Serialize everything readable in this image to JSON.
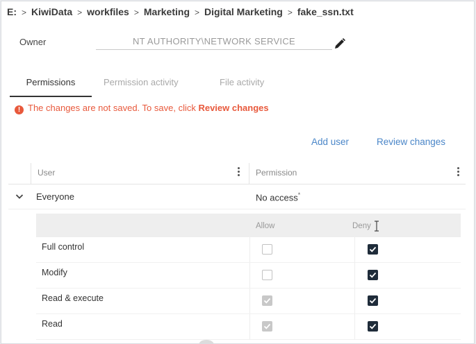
{
  "breadcrumb": [
    "E:",
    "KiwiData",
    "workfiles",
    "Marketing",
    "Digital Marketing",
    "fake_ssn.txt"
  ],
  "breadcrumb_separator": ">",
  "owner": {
    "label": "Owner",
    "value": "NT AUTHORITY\\NETWORK SERVICE"
  },
  "tabs": [
    {
      "label": "Permissions",
      "active": true
    },
    {
      "label": "Permission activity",
      "active": false
    },
    {
      "label": "File activity",
      "active": false
    }
  ],
  "warning": {
    "icon": "!",
    "text": "The changes are not saved. To save, click ",
    "link": "Review changes"
  },
  "actions": {
    "add_user": "Add user",
    "review_changes": "Review changes"
  },
  "grid": {
    "columns": [
      "User",
      "Permission"
    ],
    "rows": [
      {
        "user": "Everyone",
        "permission": "No access",
        "marker": "*",
        "expanded": true
      }
    ]
  },
  "permissions_table": {
    "columns": [
      "Allow",
      "Deny"
    ],
    "rows": [
      {
        "name": "Full control",
        "allow": "unchecked",
        "deny": "checked"
      },
      {
        "name": "Modify",
        "allow": "unchecked",
        "deny": "checked"
      },
      {
        "name": "Read & execute",
        "allow": "checked-disabled",
        "deny": "checked"
      },
      {
        "name": "Read",
        "allow": "checked-disabled",
        "deny": "checked"
      }
    ]
  },
  "colors": {
    "warning": "#e8593c",
    "link": "#4a86c8",
    "checkbox_checked": "#1f2c3a",
    "checkbox_disabled": "#c8c8c8"
  },
  "icons": {
    "edit": "pencil-icon",
    "warning": "warning-icon",
    "expand": "chevron-down-icon",
    "column_menu": "kebab-menu-icon",
    "cursor": "text-cursor-icon"
  }
}
